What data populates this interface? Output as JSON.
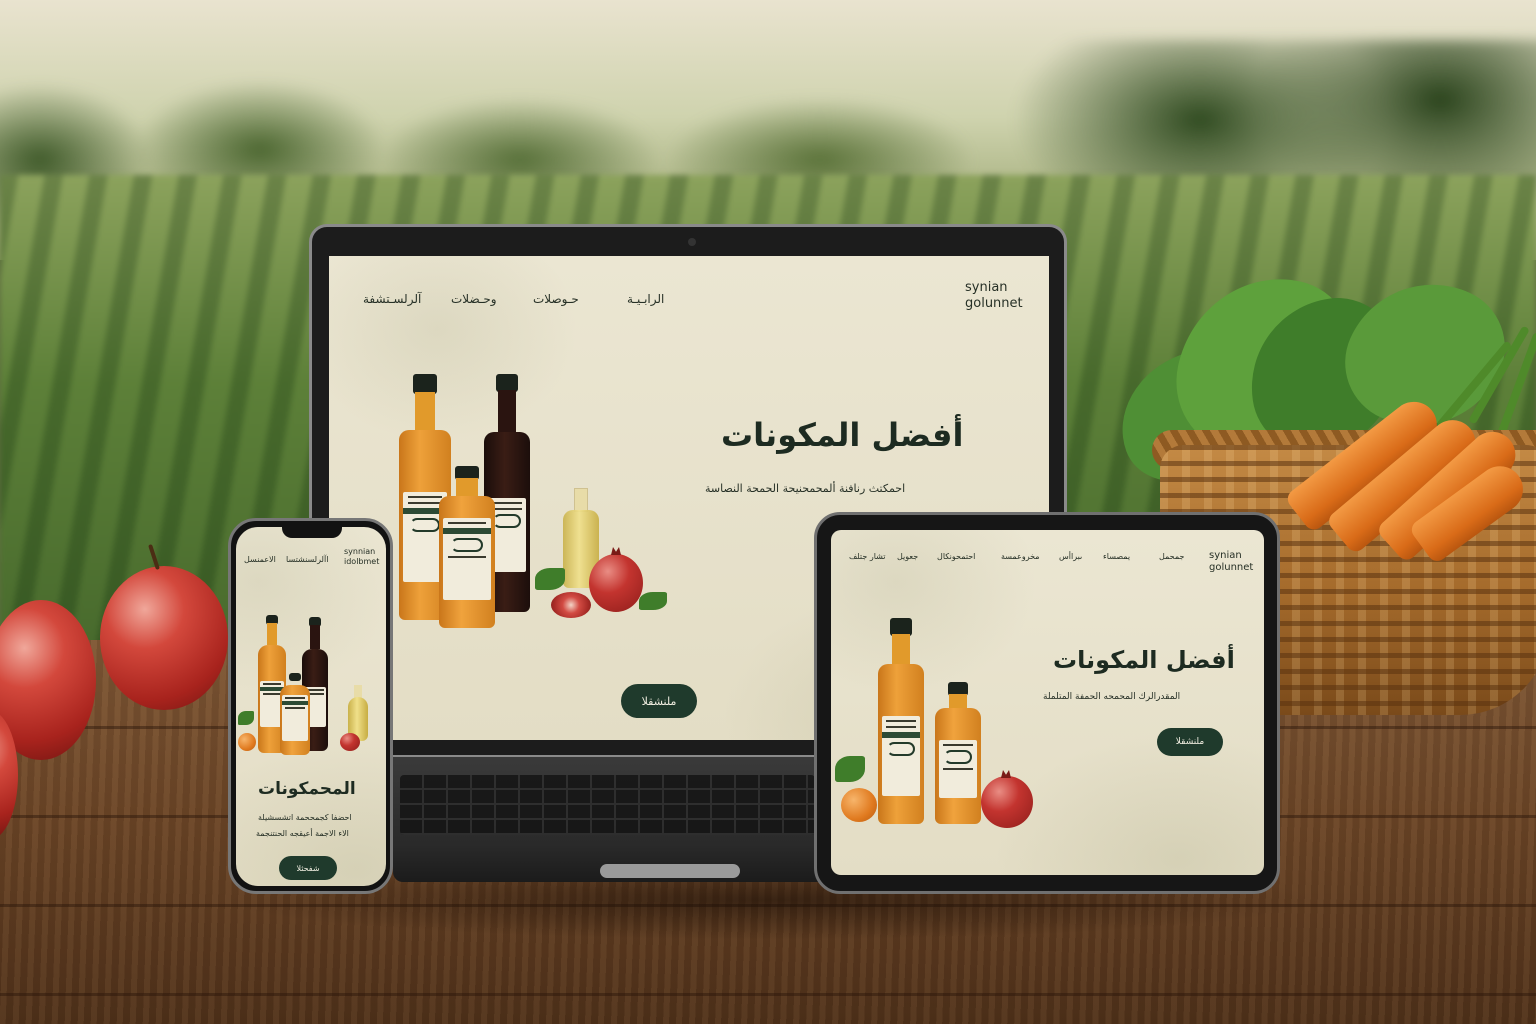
{
  "site": {
    "brand": "synian\ngolunnet",
    "laptop": {
      "nav": [
        "الرابـيـة",
        "حـوصلات",
        "وحـضلات",
        "آلرلسـتشفة"
      ],
      "hero_title": "أفضل المكونات",
      "hero_subtitle": "احمكتث رنافنة ألمحمحنيحة الحمحة النصاسة",
      "cta": "ملنشقلا"
    },
    "tablet": {
      "nav": [
        "جمحمل",
        "يمصساء",
        "ىبراأس",
        "مخروعمسة",
        "احتمحونكال",
        "جعويل",
        "تشار جتلف"
      ],
      "hero_title": "أفضل المكونات",
      "hero_subtitle": "المقدرالرك المحمحه الحمفة المتلملة",
      "cta": "ملنشقلا"
    },
    "phone": {
      "brand": "synnian\nidolbmet",
      "nav": [
        "الاعمنسل",
        "اآلرلسنشتسا"
      ],
      "hero_title": "المحمكونات",
      "hero_subtitle_line1": "احضفا كجمححمة اتشسشيلة",
      "hero_subtitle_line2": "الاء الاجمة أعيقجه الحنتنجمة",
      "cta": "شفحثلا"
    }
  },
  "bottle_labels": {
    "label_a": "MAYSBAKT",
    "label_b": "PATHFIELD"
  },
  "colors": {
    "screen_bg": "#e8e2cc",
    "accent_dark_green": "#1f3a2c",
    "text_dark": "#1d2b21",
    "juice_orange": "#d98a1f",
    "pomegranate_dark": "#2a1410"
  },
  "icons": {
    "camera": "laptop-camera-icon",
    "notch": "phone-notch-icon"
  }
}
